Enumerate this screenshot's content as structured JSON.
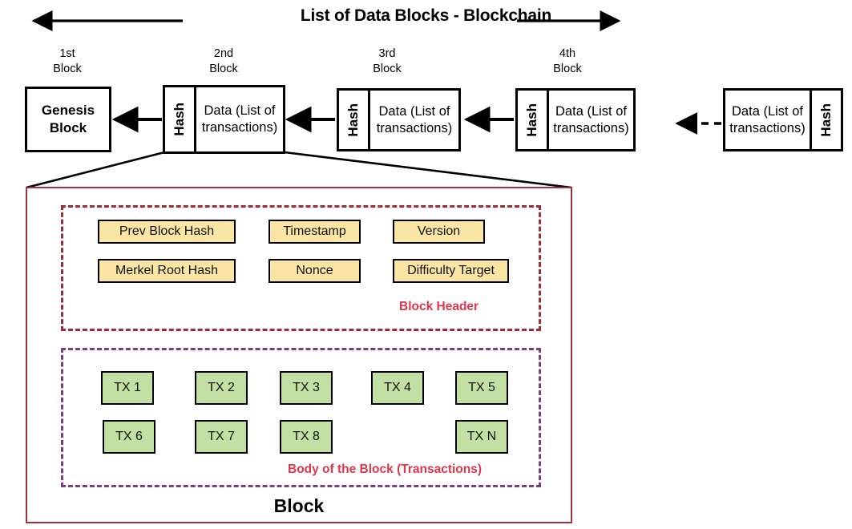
{
  "title": "List of Data Blocks - Blockchain",
  "chain": {
    "captions": [
      {
        "line1": "1st",
        "line2": "Block"
      },
      {
        "line1": "2nd",
        "line2": "Block"
      },
      {
        "line1": "3rd",
        "line2": "Block"
      },
      {
        "line1": "4th",
        "line2": "Block"
      }
    ],
    "genesis_label": "Genesis\nBlock",
    "genesis_line1": "Genesis",
    "genesis_line2": "Block",
    "hash_label": "Hash",
    "data_line1": "Data (List of",
    "data_line2": "transactions)"
  },
  "detail": {
    "header_region_label": "Block Header",
    "body_region_label": "Body of the Block (Transactions)",
    "block_label": "Block",
    "header_fields": [
      "Prev Block Hash",
      "Timestamp",
      "Version",
      "Merkel Root Hash",
      "Nonce",
      "Difficulty Target"
    ],
    "transactions": [
      "TX 1",
      "TX 2",
      "TX 3",
      "TX 4",
      "TX 5",
      "TX 6",
      "TX 7",
      "TX 8",
      "TX N"
    ]
  },
  "colors": {
    "field_fill": "#FAE5A5",
    "tx_fill": "#C2E0A3",
    "header_dash": "#9E2B3B",
    "body_dash": "#7C3F7E",
    "label_red": "#E0364C",
    "outer_border": "#A03040",
    "stroke": "#000000"
  }
}
